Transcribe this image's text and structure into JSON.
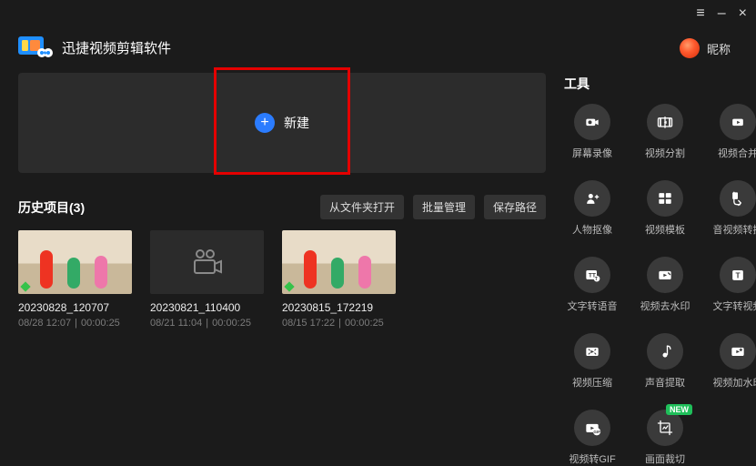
{
  "window": {
    "menu": "≡",
    "min": "–",
    "close": "×"
  },
  "header": {
    "app_title": "迅捷视频剪辑软件",
    "nickname": "昵称"
  },
  "new_panel": {
    "label": "新建"
  },
  "history": {
    "title_prefix": "历史项目",
    "count": 3,
    "actions": {
      "open_from_folder": "从文件夹打开",
      "batch_manage": "批量管理",
      "save_path": "保存路径"
    },
    "items": [
      {
        "name": "20230828_120707",
        "date": "08/28 12:07",
        "duration": "00:00:25",
        "thumb": "kitchen"
      },
      {
        "name": "20230821_110400",
        "date": "08/21 11:04",
        "duration": "00:00:25",
        "thumb": "camera"
      },
      {
        "name": "20230815_172219",
        "date": "08/15 17:22",
        "duration": "00:00:25",
        "thumb": "kitchen"
      }
    ]
  },
  "tools": {
    "title": "工具",
    "items": [
      {
        "icon": "screen-record",
        "label": "屏幕录像"
      },
      {
        "icon": "video-split",
        "label": "视频分割"
      },
      {
        "icon": "video-merge",
        "label": "视频合并"
      },
      {
        "icon": "person-cutout",
        "label": "人物抠像"
      },
      {
        "icon": "video-template",
        "label": "视频模板"
      },
      {
        "icon": "av-convert",
        "label": "音视频转换"
      },
      {
        "icon": "tts",
        "label": "文字转语音"
      },
      {
        "icon": "remove-watermark",
        "label": "视频去水印"
      },
      {
        "icon": "text-to-video",
        "label": "文字转视频"
      },
      {
        "icon": "video-compress",
        "label": "视频压缩"
      },
      {
        "icon": "audio-extract",
        "label": "声音提取"
      },
      {
        "icon": "add-watermark",
        "label": "视频加水印"
      },
      {
        "icon": "video-to-gif",
        "label": "视频转GIF"
      },
      {
        "icon": "crop",
        "label": "画面裁切",
        "badge": "NEW"
      }
    ]
  }
}
